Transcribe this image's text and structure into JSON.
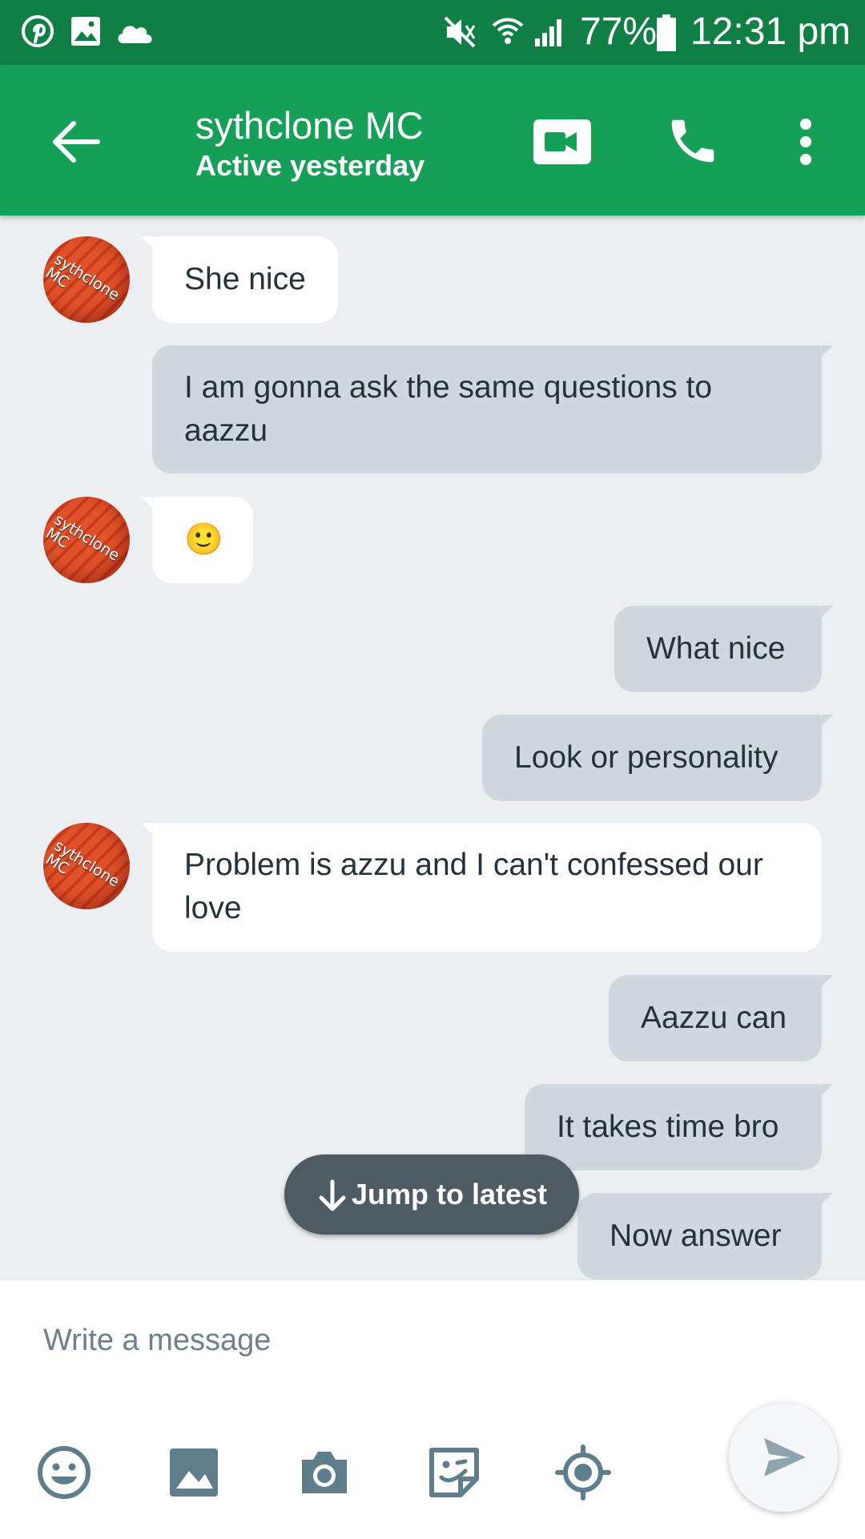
{
  "status_bar": {
    "battery": "77%",
    "time": "12:31 pm",
    "icons": [
      "pinterest-icon",
      "image-icon",
      "cloud-icon",
      "mute-icon",
      "wifi-icon",
      "signal-icon",
      "battery-icon"
    ]
  },
  "header": {
    "title": "sythclone MC",
    "subtitle": "Active yesterday",
    "icons": [
      "back-arrow-icon",
      "video-call-icon",
      "phone-icon",
      "more-vert-icon"
    ]
  },
  "avatar_text": "sythclone\nMC",
  "messages": [
    {
      "from": "them",
      "text": "She nice"
    },
    {
      "from": "me",
      "text": "I am gonna ask the same questions to aazzu"
    },
    {
      "from": "them",
      "text": "🙂"
    },
    {
      "from": "me",
      "text": "What nice"
    },
    {
      "from": "me",
      "text": "Look or personality"
    },
    {
      "from": "them",
      "text": "Problem is azzu and I can't confessed our love"
    },
    {
      "from": "me",
      "text": "Aazzu can"
    },
    {
      "from": "me",
      "text": "It takes time bro"
    },
    {
      "from": "me",
      "text": "Now answer"
    }
  ],
  "jump_button": {
    "label": "Jump to latest"
  },
  "composer": {
    "placeholder": "Write a message",
    "tools": [
      "emoji-icon",
      "gallery-icon",
      "camera-icon",
      "sticker-icon",
      "location-icon",
      "send-icon"
    ]
  },
  "colors": {
    "status_bar": "#0f7f45",
    "app_bar": "#16a057",
    "chat_bg": "#eceff1",
    "incoming_bubble": "#ffffff",
    "outgoing_bubble": "#cfd8dc",
    "jump_button": "#4f5b62",
    "icon_gray": "#607d8b"
  }
}
